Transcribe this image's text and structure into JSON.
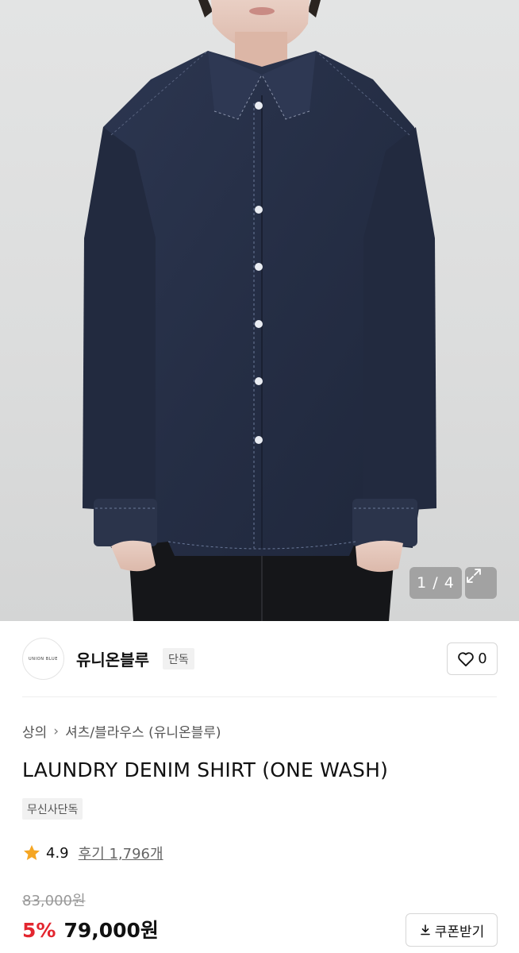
{
  "gallery": {
    "counter": "1 / 4",
    "icons": {
      "expand": "expand-arrows-icon"
    }
  },
  "brand": {
    "logo_text": "UNION BLUE",
    "name": "유니온블루",
    "badge": "단독",
    "like_count": "0",
    "icons": {
      "like": "heart-outline-icon"
    }
  },
  "product": {
    "breadcrumb": [
      "상의",
      "셔츠/블라우스 (유니온블루)"
    ],
    "breadcrumb_separator": "›",
    "title": "LAUNDRY DENIM SHIRT (ONE WASH)",
    "exclusive_badge": "무신사단독",
    "rating": {
      "score": "4.9",
      "reviews_label": "후기 1,796개",
      "star_color": "#f5a623"
    },
    "original_price": "83,000원",
    "discount": "5%",
    "price": "79,000원",
    "discount_color": "#e3262f",
    "coupon_label": "쿠폰받기",
    "icons": {
      "coupon": "download-icon",
      "star": "star-icon"
    }
  }
}
